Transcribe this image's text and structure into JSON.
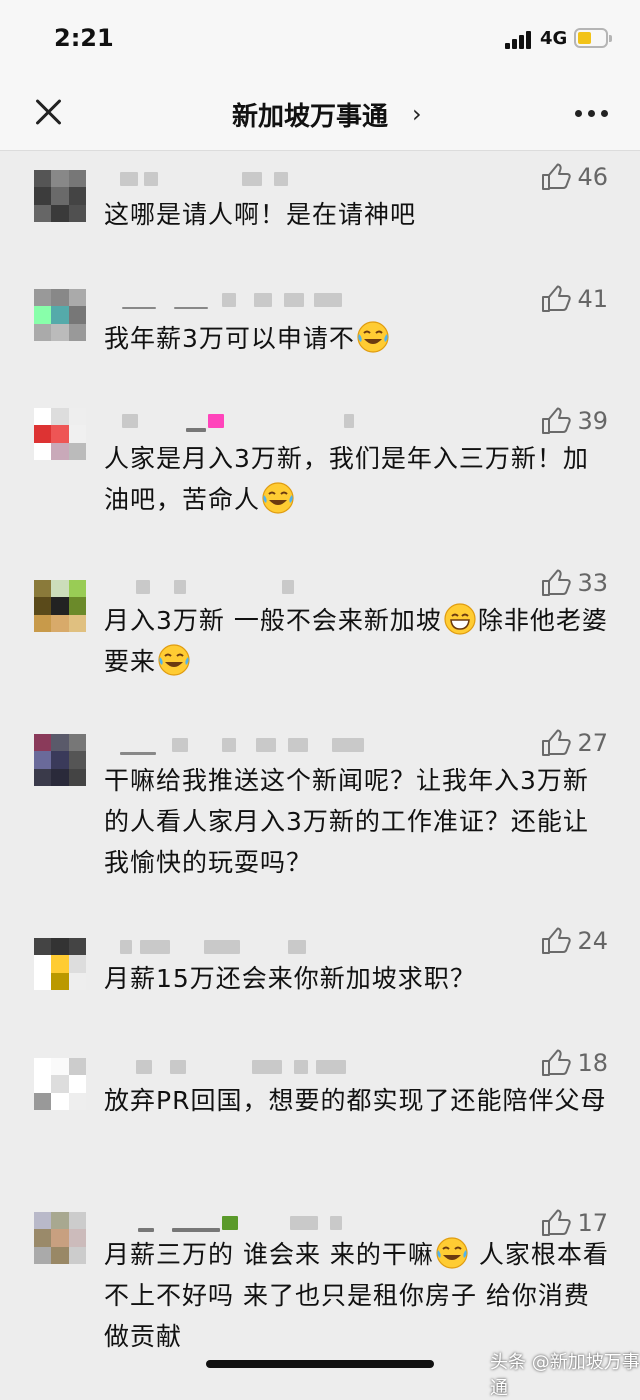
{
  "status": {
    "time": "2:21",
    "network": "4G"
  },
  "nav": {
    "title": "新加坡万事通",
    "chevron": "›"
  },
  "comments": [
    {
      "likes": "46",
      "text": "这哪是请人啊！是在请神吧"
    },
    {
      "likes": "41",
      "text": "我年薪3万可以申请不",
      "emoji": "laugh-cry"
    },
    {
      "likes": "39",
      "text_a": "人家是月入3万新，我们是年入三万新！加油吧，苦命人",
      "emoji": "laugh-cry"
    },
    {
      "likes": "33",
      "text_a": "月入3万新 一般不会来新加坡",
      "emoji_a": "grin",
      "text_b": "除非他老婆要来",
      "emoji_b": "laugh-cry"
    },
    {
      "likes": "27",
      "text": "干嘛给我推送这个新闻呢？让我年入3万新的人看人家月入3万新的工作准证？还能让我愉快的玩耍吗？"
    },
    {
      "likes": "24",
      "text": "月薪15万还会来你新加坡求职？"
    },
    {
      "likes": "18",
      "text": "放弃PR回国，想要的都实现了还能陪伴父母"
    },
    {
      "likes": "17",
      "text_a": "月薪三万的 谁会来 来的干嘛",
      "emoji": "laugh-cry",
      "text_b": " 人家根本看不上不好吗 来了也只是租你房子 给你消费做贡献"
    }
  ],
  "watermark": "头条 @新加坡万事通"
}
